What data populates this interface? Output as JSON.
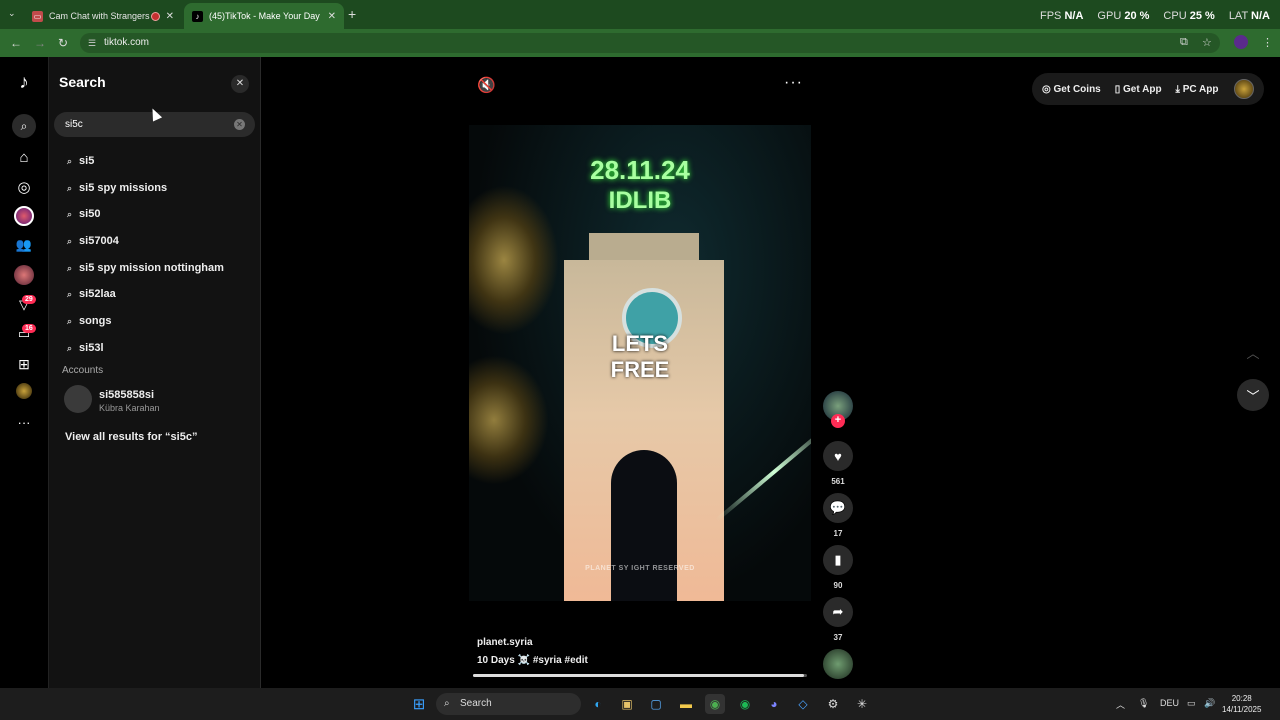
{
  "browser": {
    "tabs": [
      {
        "title": "Cam Chat with Strangers o",
        "icon": "camchat-favicon"
      },
      {
        "title": "(45)TikTok - Make Your Day",
        "icon": "tiktok-favicon"
      }
    ],
    "new_tab_label": "+",
    "url": "tiktok.com",
    "stats": {
      "fps_label": "FPS",
      "fps_value": "N/A",
      "gpu_label": "GPU",
      "gpu_value": "20",
      "cpu_label": "CPU",
      "cpu_value": "25",
      "lat_label": "LAT",
      "lat_value": "N/A",
      "percent": "%"
    }
  },
  "rail": {
    "badges": {
      "friends": "29",
      "inbox": "16"
    }
  },
  "search_panel": {
    "title": "Search",
    "query": "si5c",
    "suggestions": [
      "si5",
      "si5 spy missions",
      "si50",
      "si57004",
      "si5 spy mission nottingham",
      "si52laa",
      "songs",
      "si53l"
    ],
    "accounts_heading": "Accounts",
    "account": {
      "username": "si585858si",
      "name": "Kübra Karahan"
    },
    "view_all": "View all results for “si5c”"
  },
  "top_actions": {
    "get_coins": "Get Coins",
    "get_app": "Get App",
    "pc_app": "PC App"
  },
  "video": {
    "overlay_date": "28.11.24",
    "overlay_location": "IDLIB",
    "overlay_lets": "LETS",
    "overlay_free": "FREE",
    "watermark": "PLANET SY          IGHT RESERVED",
    "author": "planet.syria",
    "caption": "10 Days ☠️ #syria  #edit",
    "progress": 0.99
  },
  "actions": {
    "likes": "561",
    "comments": "17",
    "saves": "90",
    "shares": "37"
  },
  "taskbar": {
    "search_label": "Search",
    "language": "DEU",
    "time": "20:28",
    "date": "14/11/2025"
  }
}
